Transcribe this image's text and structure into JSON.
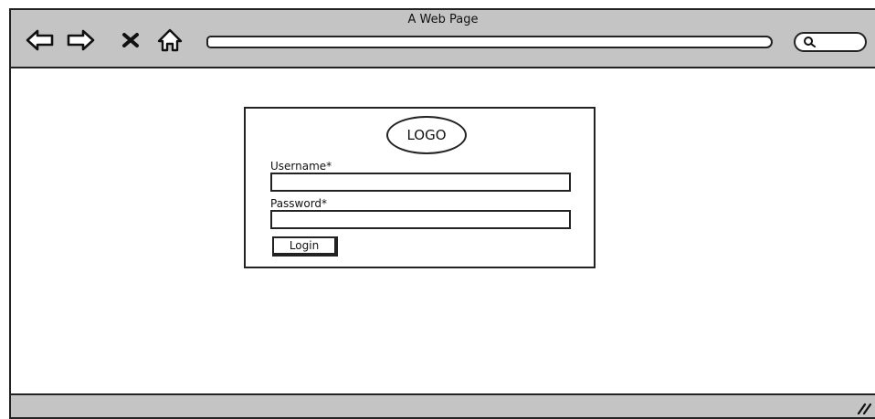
{
  "window": {
    "title": "A Web Page"
  },
  "toolbar": {
    "icons": {
      "back": "back-arrow-icon",
      "forward": "forward-arrow-icon",
      "close": "close-icon",
      "home": "home-icon",
      "search": "search-icon"
    },
    "url": ""
  },
  "login": {
    "logo_text": "LOGO",
    "username_label": "Username*",
    "username_value": "",
    "password_label": "Password*",
    "password_value": "",
    "button_label": "Login"
  },
  "colors": {
    "chrome_gray": "#c4c4c4",
    "outline": "#222222",
    "background": "#ffffff"
  }
}
